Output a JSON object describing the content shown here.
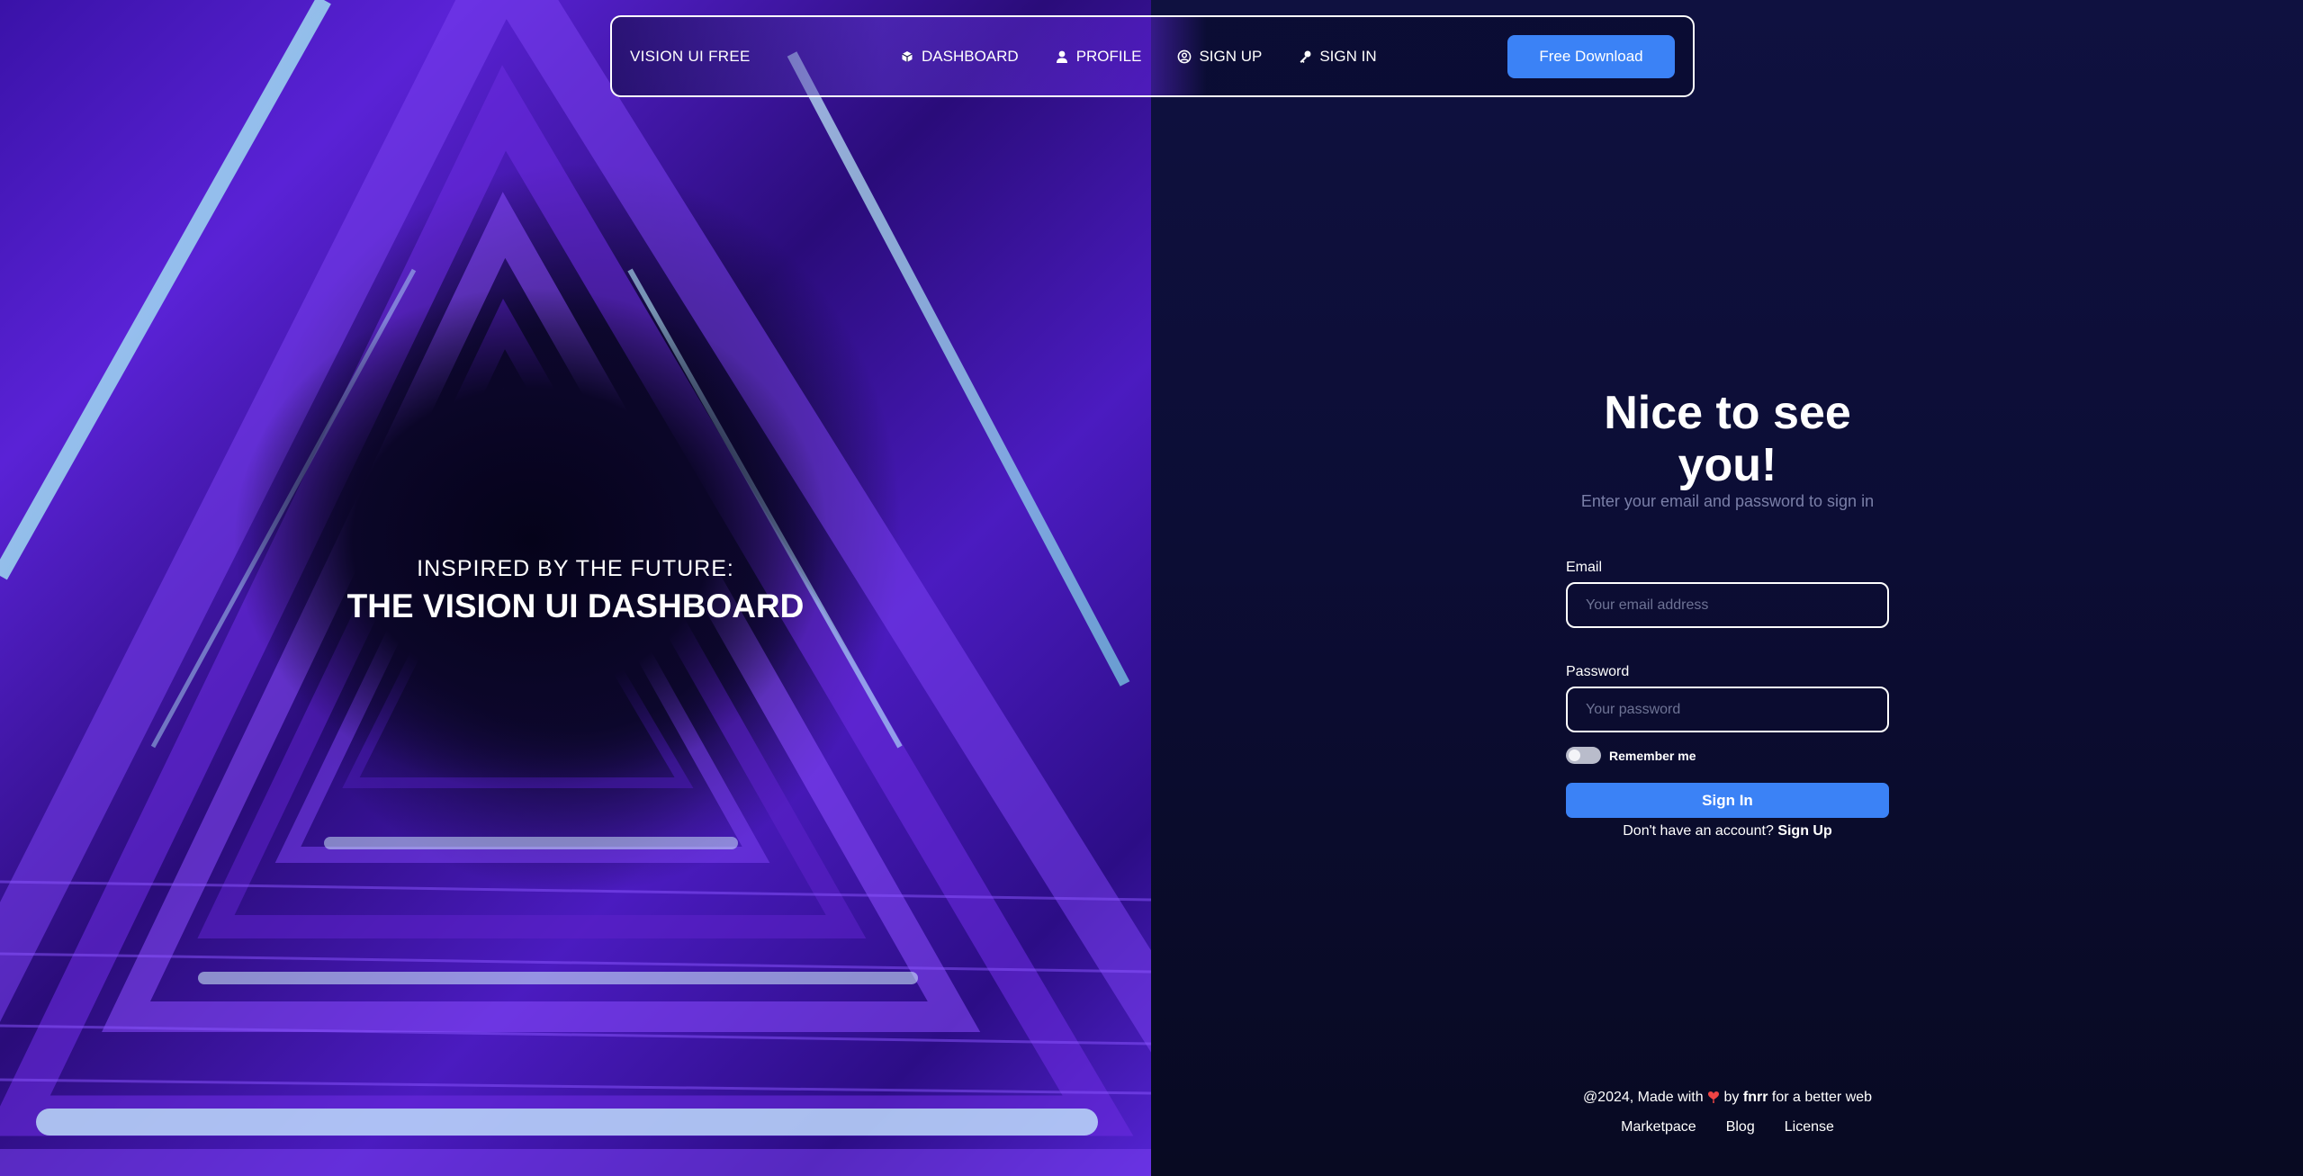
{
  "colors": {
    "accent": "#3b82f6",
    "background": "#0b0c2f",
    "heart": "#ef4444"
  },
  "hero": {
    "subtitle": "INSPIRED BY THE FUTURE:",
    "title": "THE VISION UI DASHBOARD"
  },
  "navbar": {
    "brand": "VISION UI FREE",
    "links": [
      {
        "label": "DASHBOARD",
        "icon": "dashboard-icon"
      },
      {
        "label": "PROFILE",
        "icon": "person-icon"
      },
      {
        "label": "SIGN UP",
        "icon": "user-circle-icon"
      },
      {
        "label": "SIGN IN",
        "icon": "key-icon"
      }
    ],
    "download_label": "Free Download"
  },
  "signin": {
    "title": "Nice to see you!",
    "subtitle": "Enter your email and password to sign in",
    "email_label": "Email",
    "email_placeholder": "Your email address",
    "email_value": "",
    "password_label": "Password",
    "password_placeholder": "Your password",
    "password_value": "",
    "remember_label": "Remember me",
    "remember_checked": false,
    "submit_label": "Sign In",
    "no_account_text": "Don't have an account?",
    "signup_link": "Sign Up"
  },
  "footer": {
    "prefix": "@2024, Made with",
    "by_text": "by",
    "author": "fnrr",
    "suffix": "for a better web",
    "links": [
      "Marketpace",
      "Blog",
      "License"
    ]
  }
}
